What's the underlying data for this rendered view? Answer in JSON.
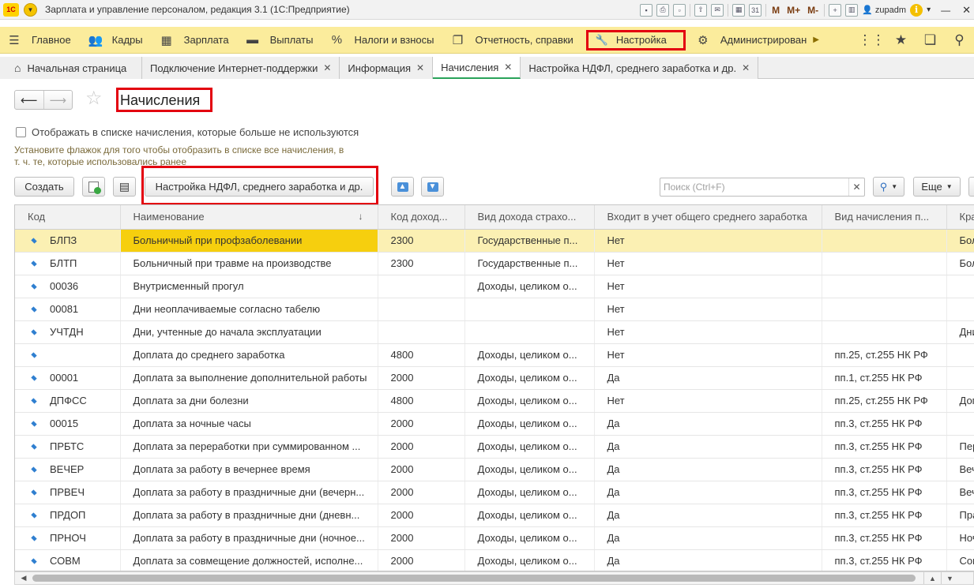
{
  "app": {
    "title": "Зарплата и управление персоналом, редакция 3.1  (1С:Предприятие)",
    "logo": "1С",
    "user": "zupadm",
    "toolbar_m": [
      "M",
      "M+",
      "M-"
    ]
  },
  "sections": [
    {
      "icon": "☰",
      "label": "Главное"
    },
    {
      "icon": "👥",
      "label": "Кадры"
    },
    {
      "icon": "▦",
      "label": "Зарплата"
    },
    {
      "icon": "▬",
      "label": "Выплаты"
    },
    {
      "icon": "%",
      "label": "Налоги и взносы"
    },
    {
      "icon": "❐",
      "label": "Отчетность, справки"
    },
    {
      "icon": "🔧",
      "label": "Настройка"
    },
    {
      "icon": "⚙",
      "label": "Администрирован"
    }
  ],
  "tabs": [
    {
      "label": "Начальная страница"
    },
    {
      "label": "Подключение Интернет-поддержки"
    },
    {
      "label": "Информация"
    },
    {
      "label": "Начисления"
    },
    {
      "label": "Настройка НДФЛ, среднего заработка и др."
    }
  ],
  "form": {
    "title": "Начисления",
    "checkbox_label": "Отображать в списке начисления, которые больше не используются",
    "hint": "Установите флажок для того чтобы отобразить в списке все начисления, в т. ч. те, которые использовались ранее"
  },
  "commands": {
    "create": "Создать",
    "ndfl": "Настройка НДФЛ, среднего заработка и др.",
    "search_placeholder": "Поиск (Ctrl+F)",
    "more": "Еще"
  },
  "table": {
    "columns": [
      "Код",
      "Наименование",
      "Код доход...",
      "Вид дохода страхо...",
      "Входит в учет общего среднего заработка",
      "Вид начисления п...",
      "Кра"
    ],
    "rows": [
      [
        "БЛПЗ",
        "Больничный при профзаболевании",
        "2300",
        "Государственные п...",
        "Нет",
        "",
        "Бол"
      ],
      [
        "БЛТП",
        "Больничный при травме на производстве",
        "2300",
        "Государственные п...",
        "Нет",
        "",
        "Бол"
      ],
      [
        "00036",
        "Внутрисменный прогул",
        "",
        "Доходы, целиком о...",
        "Нет",
        "",
        ""
      ],
      [
        "00081",
        "Дни неоплачиваемые согласно табелю",
        "",
        "",
        "Нет",
        "",
        ""
      ],
      [
        "УЧТДН",
        "Дни, учтенные до начала эксплуатации",
        "",
        "",
        "Нет",
        "",
        "Дни"
      ],
      [
        "",
        "Доплата до среднего заработка",
        "4800",
        "Доходы, целиком о...",
        "Нет",
        "пп.25, ст.255 НК РФ",
        ""
      ],
      [
        "00001",
        "Доплата за выполнение дополнительной работы",
        "2000",
        "Доходы, целиком о...",
        "Да",
        "пп.1, ст.255 НК РФ",
        ""
      ],
      [
        "ДПФСС",
        "Доплата за дни болезни",
        "4800",
        "Доходы, целиком о...",
        "Нет",
        "пп.25, ст.255 НК РФ",
        "Доп"
      ],
      [
        "00015",
        "Доплата за ночные часы",
        "2000",
        "Доходы, целиком о...",
        "Да",
        "пп.3, ст.255 НК РФ",
        ""
      ],
      [
        "ПРБТС",
        "Доплата за переработки при суммированном ...",
        "2000",
        "Доходы, целиком о...",
        "Да",
        "пп.3, ст.255 НК РФ",
        "Пер"
      ],
      [
        "ВЕЧЕР",
        "Доплата за работу в вечернее время",
        "2000",
        "Доходы, целиком о...",
        "Да",
        "пп.3, ст.255 НК РФ",
        "Веч"
      ],
      [
        "ПРВЕЧ",
        "Доплата за работу в праздничные дни (вечерн...",
        "2000",
        "Доходы, целиком о...",
        "Да",
        "пп.3, ст.255 НК РФ",
        "Веч"
      ],
      [
        "ПРДОП",
        "Доплата за работу в праздничные дни (дневн...",
        "2000",
        "Доходы, целиком о...",
        "Да",
        "пп.3, ст.255 НК РФ",
        "Пра"
      ],
      [
        "ПРНОЧ",
        "Доплата за работу в праздничные дни (ночное...",
        "2000",
        "Доходы, целиком о...",
        "Да",
        "пп.3, ст.255 НК РФ",
        "Ноч"
      ],
      [
        "СОВМ",
        "Доплата за совмещение должностей, исполне...",
        "2000",
        "Доходы, целиком о...",
        "Да",
        "пп.3, ст.255 НК РФ",
        "Сов"
      ]
    ]
  }
}
